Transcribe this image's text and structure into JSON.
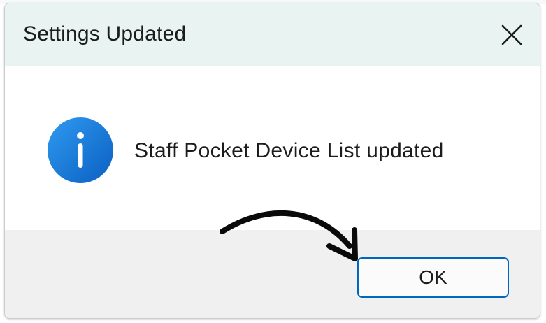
{
  "dialog": {
    "title": "Settings Updated",
    "message": "Staff Pocket Device List updated",
    "ok_label": "OK"
  },
  "icons": {
    "close": "close-icon",
    "info": "info-icon",
    "annotation": "curved-arrow-annotation"
  },
  "colors": {
    "title_bar": "#e9f4f2",
    "footer": "#f0f0f0",
    "accent": "#0067c0",
    "info_icon": "#1a7fd9"
  }
}
